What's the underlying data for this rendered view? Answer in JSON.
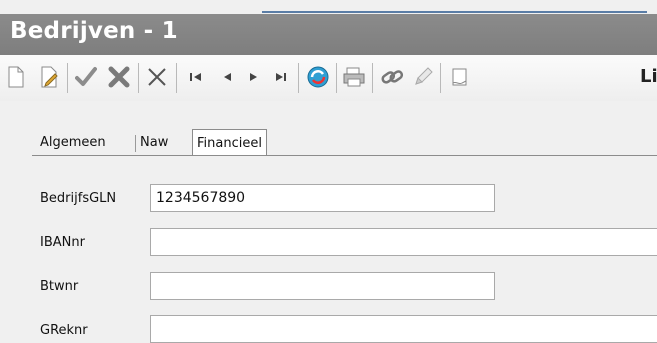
{
  "window": {
    "title": "Bedrijven - 1"
  },
  "toolbar": {
    "buttons": [
      {
        "name": "new-document-icon"
      },
      {
        "name": "edit-document-icon"
      },
      {
        "name": "checkmark-icon"
      },
      {
        "name": "delete-x-icon"
      },
      {
        "name": "close-x-icon"
      },
      {
        "name": "first-record-icon"
      },
      {
        "name": "previous-record-icon"
      },
      {
        "name": "next-record-icon"
      },
      {
        "name": "last-record-icon"
      },
      {
        "name": "refresh-icon"
      },
      {
        "name": "print-icon"
      },
      {
        "name": "link-icon"
      },
      {
        "name": "pen-icon"
      },
      {
        "name": "list-icon"
      }
    ],
    "trailing_label": "Lij"
  },
  "tabs": [
    {
      "label": "Algemeen",
      "active": false
    },
    {
      "label": "Naw",
      "active": false
    },
    {
      "label": "Financieel",
      "active": true
    }
  ],
  "form": {
    "fields": [
      {
        "label": "BedrijfsGLN",
        "value": "1234567890"
      },
      {
        "label": "IBANnr",
        "value": ""
      },
      {
        "label": "Btwnr",
        "value": ""
      },
      {
        "label": "GReknr",
        "value": ""
      }
    ]
  },
  "colors": {
    "titlebar": "#828282",
    "accent_line": "#5a7da6"
  }
}
